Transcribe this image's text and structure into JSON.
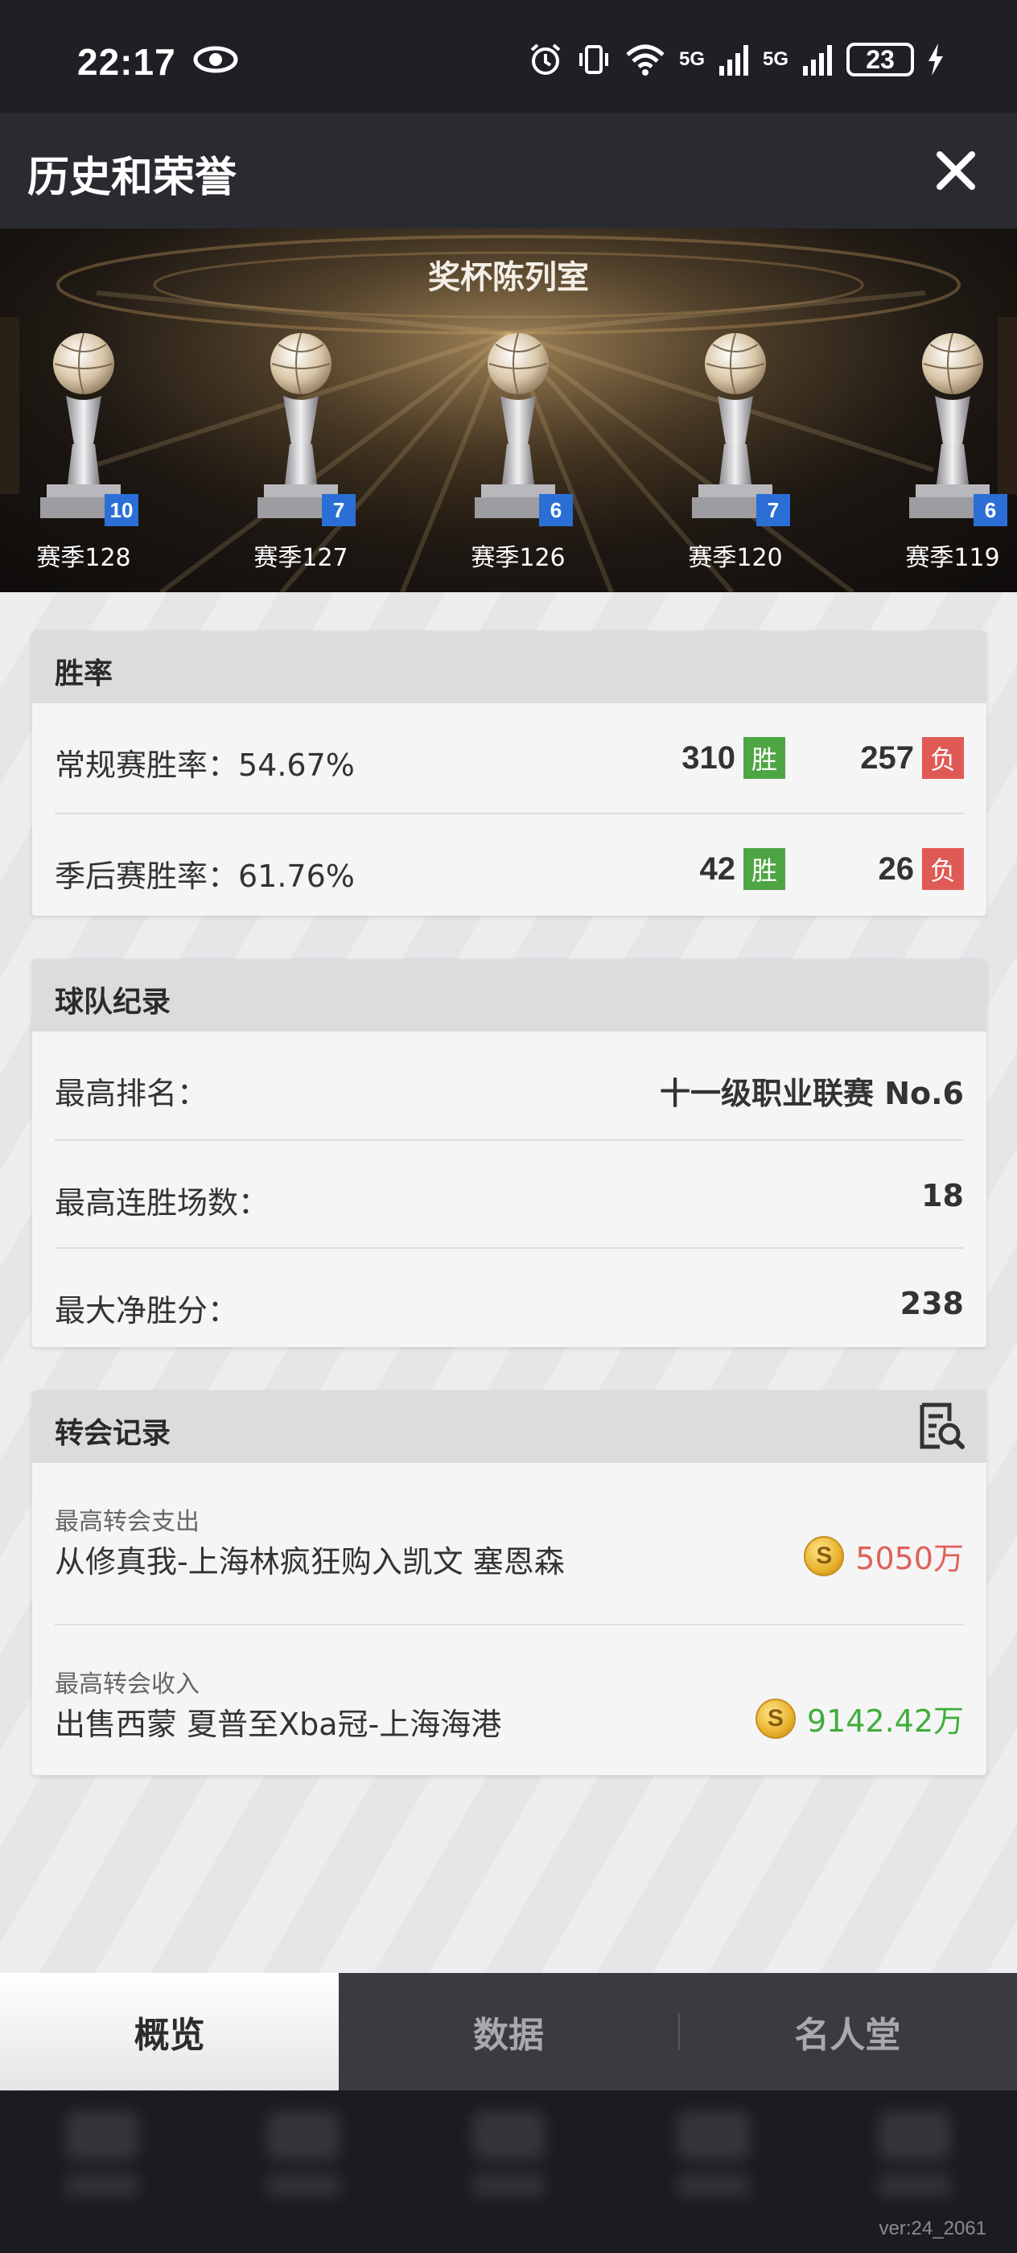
{
  "status_bar": {
    "time": "22:17",
    "network1": "5G",
    "network2": "5G",
    "battery": "23"
  },
  "header": {
    "title": "历史和荣誉"
  },
  "trophy_room": {
    "title": "奖杯陈列室",
    "trophies": [
      {
        "season": "赛季128",
        "count": "10"
      },
      {
        "season": "赛季127",
        "count": "7"
      },
      {
        "season": "赛季126",
        "count": "6"
      },
      {
        "season": "赛季120",
        "count": "7"
      },
      {
        "season": "赛季119",
        "count": "6"
      }
    ]
  },
  "win_rate": {
    "title": "胜率",
    "regular": {
      "label": "常规赛胜率：54.67%",
      "wins": "310",
      "losses": "257"
    },
    "playoff": {
      "label": "季后赛胜率：61.76%",
      "wins": "42",
      "losses": "26"
    },
    "win_tag": "胜",
    "loss_tag": "负"
  },
  "team_record": {
    "title": "球队纪录",
    "rows": [
      {
        "label": "最高排名：",
        "value": "十一级职业联赛 No.6"
      },
      {
        "label": "最高连胜场数：",
        "value": "18"
      },
      {
        "label": "最大净胜分：",
        "value": "238"
      }
    ]
  },
  "transfer_record": {
    "title": "转会记录",
    "rows": [
      {
        "sub": "最高转会支出",
        "main": "从修真我-上海林疯狂购入凯文 塞恩森",
        "amount": "5050万",
        "color": "#e0605a"
      },
      {
        "sub": "最高转会收入",
        "main": "出售西蒙 夏普至Xba冠-上海海港",
        "amount": "9142.42万",
        "color": "#3fae3a"
      }
    ]
  },
  "tabs": [
    {
      "label": "概览",
      "active": true
    },
    {
      "label": "数据",
      "active": false
    },
    {
      "label": "名人堂",
      "active": false
    }
  ],
  "version": "ver:24_2061",
  "colors": {
    "win": "#4ea544",
    "loss": "#df5a55",
    "badge": "#2b6fd6",
    "header_bg": "#2a2b31"
  }
}
